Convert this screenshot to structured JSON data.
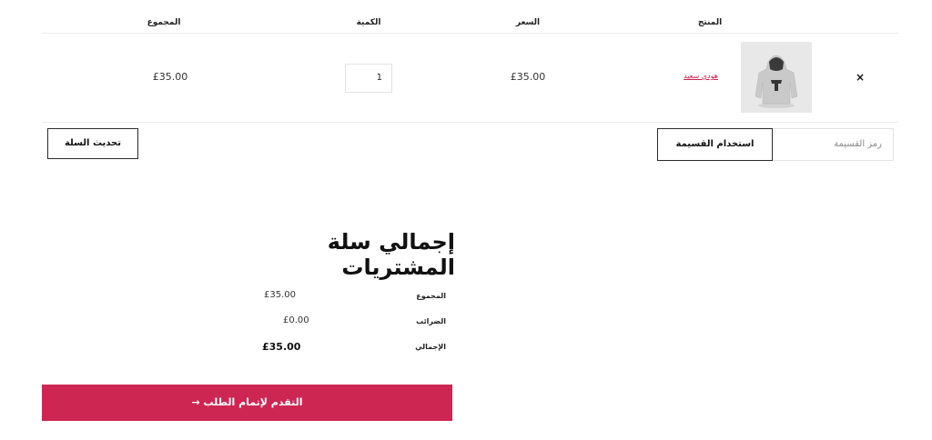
{
  "cart_table": {
    "headers": {
      "product": "المنتج",
      "price": "السعر",
      "quantity": "الكمية",
      "subtotal": "المجموع"
    },
    "rows": [
      {
        "remove": "×",
        "product_image": "hoodie-image",
        "product_name": "هودي سعيد",
        "price": "£35.00",
        "quantity": "1",
        "subtotal": "£35.00"
      }
    ]
  },
  "actions": {
    "coupon_placeholder": "رمز القسيمة",
    "apply_coupon_label": "استخدام القسيمة",
    "update_cart_label": "تحديث السلة"
  },
  "cart_totals": {
    "title": "إجمالي سلة المشتريات",
    "rows": [
      {
        "label": "المجموع",
        "value": "£35.00"
      },
      {
        "label": "الضرائب",
        "value": "£0.00"
      },
      {
        "label": "الإجمالي",
        "value": "£35.00"
      }
    ],
    "checkout_label": "التقدم لإتمام الطلب →"
  },
  "colors": {
    "accent": "#cd2653",
    "border": "#e3e3e3",
    "background": "#ffffff"
  },
  "icons": {
    "remove": "close-icon",
    "product": "hoodie-image"
  }
}
